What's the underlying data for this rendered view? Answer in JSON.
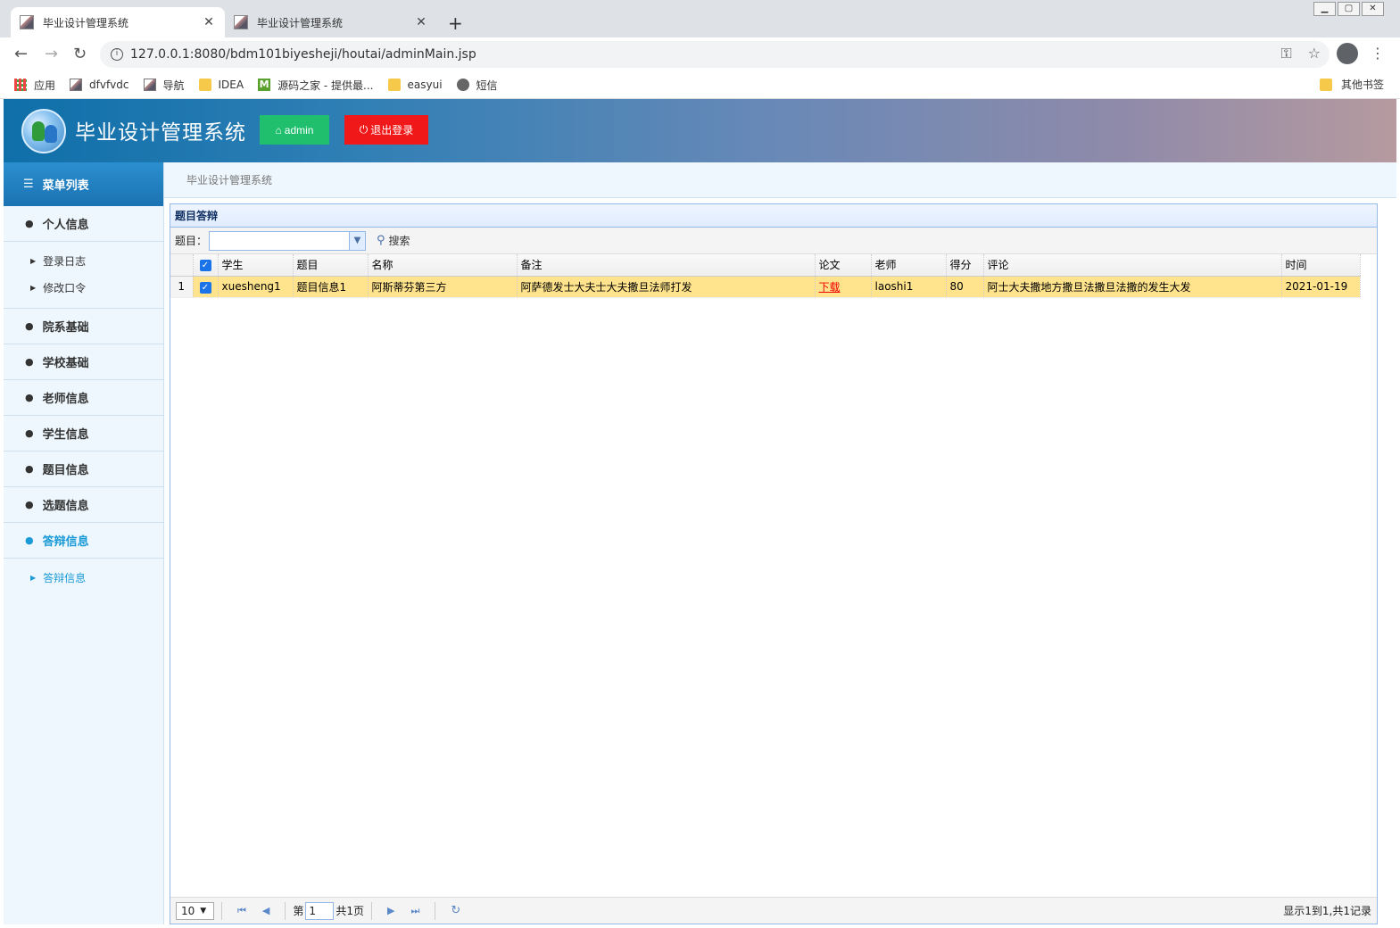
{
  "browser": {
    "tabs": [
      {
        "title": "毕业设计管理系统",
        "close": "✕"
      },
      {
        "title": "毕业设计管理系统",
        "close": "✕"
      }
    ],
    "new_tab": "+",
    "url": "127.0.0.1:8080/bdm101biyesheji/houtai/adminMain.jsp",
    "bookmarks": [
      {
        "label": "应用",
        "icon": "apps-grid-icon"
      },
      {
        "label": "dfvfvdc",
        "icon": "page-icon"
      },
      {
        "label": "导航",
        "icon": "page-icon"
      },
      {
        "label": "IDEA",
        "icon": "folder-icon"
      },
      {
        "label": "源码之家 - 提供最...",
        "icon": "m-logo-icon",
        "badge": "M"
      },
      {
        "label": "easyui",
        "icon": "folder-icon"
      },
      {
        "label": "短信",
        "icon": "globe-icon"
      }
    ],
    "other_bookmarks": "其他书签"
  },
  "header": {
    "system_name": "毕业设计管理系统",
    "admin_label": "admin",
    "logout_label": "退出登录"
  },
  "sidebar": {
    "menu_title": "菜单列表",
    "groups": [
      {
        "label": "个人信息",
        "subs": [
          "登录日志",
          "修改口令"
        ]
      },
      {
        "label": "院系基础"
      },
      {
        "label": "学校基础"
      },
      {
        "label": "老师信息"
      },
      {
        "label": "学生信息"
      },
      {
        "label": "题目信息"
      },
      {
        "label": "选题信息"
      },
      {
        "label": "答辩信息",
        "active": true,
        "subs": [
          "答辩信息"
        ]
      }
    ]
  },
  "breadcrumb": "毕业设计管理系统",
  "panel": {
    "title": "题目答辩",
    "filter_label": "题目：",
    "filter_value": "",
    "search_label": "搜索",
    "columns": [
      "学生",
      "题目",
      "名称",
      "备注",
      "论文",
      "老师",
      "得分",
      "评论",
      "时间"
    ],
    "rows": [
      {
        "rownum": "1",
        "checked": true,
        "cells": [
          "xuesheng1",
          "题目信息1",
          "阿斯蒂芬第三方",
          "阿萨德发士大夫士大夫撒旦法师打发",
          "下载",
          "laoshi1",
          "80",
          "阿士大夫撒地方撒旦法撒旦法撒的发生大发",
          "2021-01-19"
        ]
      }
    ],
    "pager": {
      "page_size": "10",
      "page_prefix": "第",
      "page_number": "1",
      "page_suffix": "共1页",
      "info": "显示1到1,共1记录"
    }
  },
  "colors": {
    "admin_button": "#1fbf6d",
    "logout_button": "#f01818",
    "selected_row": "#ffe48d",
    "active_menu": "#1a9ad6"
  }
}
